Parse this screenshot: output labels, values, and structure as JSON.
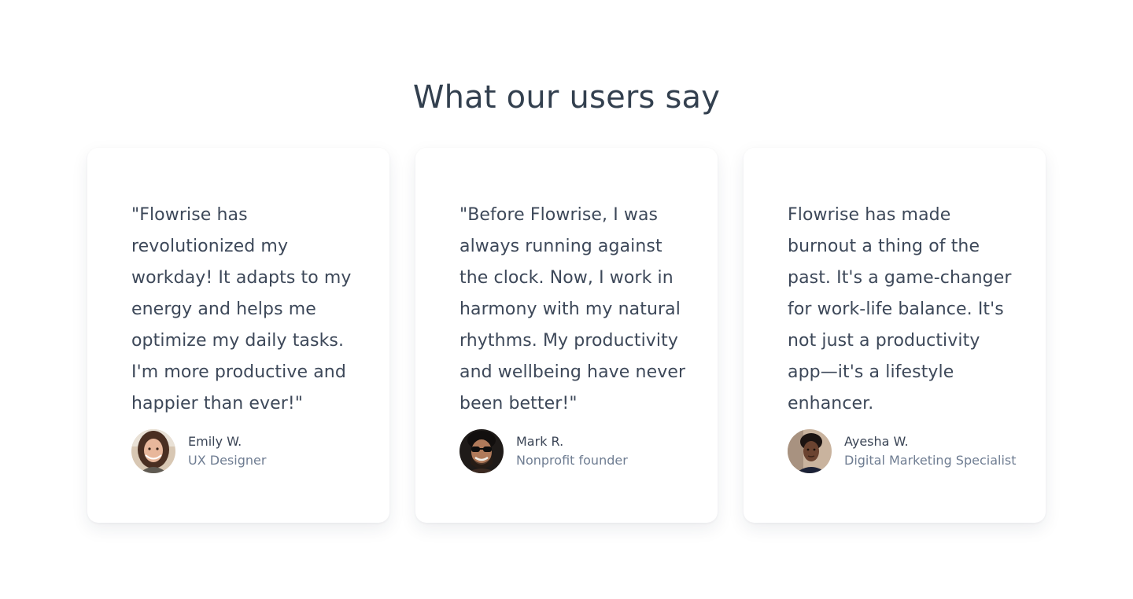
{
  "section": {
    "title": "What our users say"
  },
  "testimonials": [
    {
      "quote": "\"Flowrise has revolutionized my workday! It adapts to my energy and helps me optimize my daily tasks. I'm more productive and happier than ever!\"",
      "name": "Emily W.",
      "role": "UX Designer",
      "avatar_icon": "avatar-emily-photo"
    },
    {
      "quote": "\"Before Flowrise, I was always running against the clock. Now, I work in harmony with my natural rhythms. My productivity and wellbeing have never been better!\"",
      "name": "Mark R.",
      "role": "Nonprofit founder",
      "avatar_icon": "avatar-mark-photo"
    },
    {
      "quote": "Flowrise has made burnout a thing of the past. It's a game-changer for work-life balance. It's not just a productivity app—it's a lifestyle enhancer.",
      "name": "Ayesha W.",
      "role": "Digital Marketing Specialist",
      "avatar_icon": "avatar-ayesha-photo"
    }
  ],
  "colors": {
    "title": "#33404f",
    "text": "#3d4859",
    "muted": "#6f7d92",
    "card_bg": "#ffffff"
  }
}
